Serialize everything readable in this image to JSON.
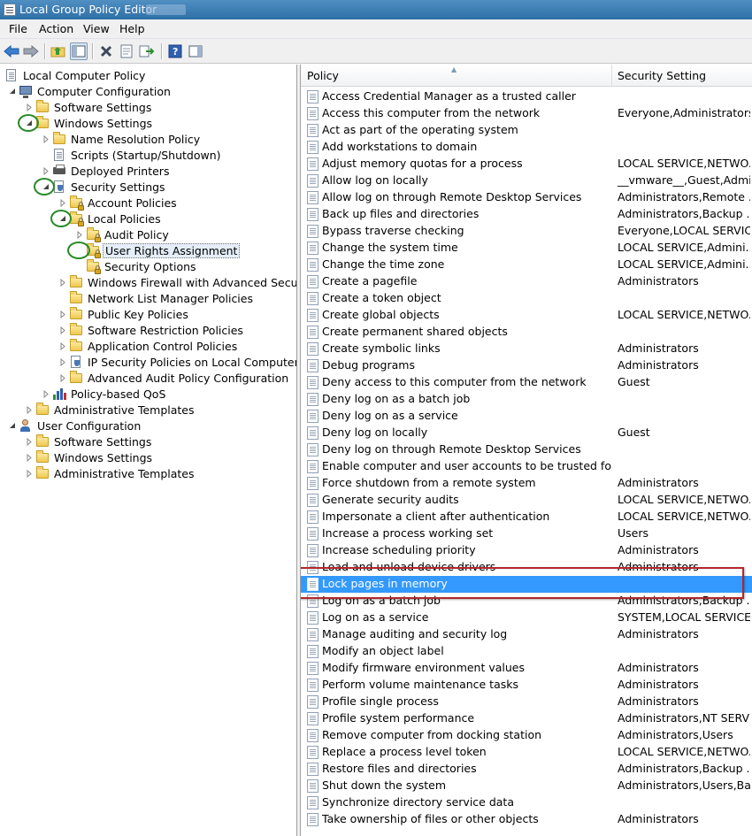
{
  "window": {
    "title": "Local Group Policy Editor"
  },
  "menu": [
    "File",
    "Action",
    "View",
    "Help"
  ],
  "toolbar": {
    "buttons": [
      "back-icon",
      "forward-icon",
      "up-folder-icon",
      "show-hide-tree-icon",
      "delete-icon",
      "properties-icon",
      "export-list-icon",
      "help-icon",
      "show-hide-action-pane-icon"
    ]
  },
  "tree": [
    {
      "label": "Local Computer Policy",
      "icon": "doc",
      "expander": "none"
    },
    {
      "label": "Computer Configuration",
      "icon": "computer",
      "expander": "expanded"
    },
    {
      "label": "Software Settings",
      "icon": "folder",
      "expander": "collapsed"
    },
    {
      "label": "Windows Settings",
      "icon": "folder",
      "expander": "expanded"
    },
    {
      "label": "Name Resolution Policy",
      "icon": "folder",
      "expander": "collapsed"
    },
    {
      "label": "Scripts (Startup/Shutdown)",
      "icon": "doc",
      "expander": "none"
    },
    {
      "label": "Deployed Printers",
      "icon": "printer",
      "expander": "collapsed"
    },
    {
      "label": "Security Settings",
      "icon": "shield",
      "expander": "expanded"
    },
    {
      "label": "Account Policies",
      "icon": "folder-lock",
      "expander": "collapsed"
    },
    {
      "label": "Local Policies",
      "icon": "folder-lock",
      "expander": "expanded"
    },
    {
      "label": "Audit Policy",
      "icon": "folder-lock",
      "expander": "collapsed"
    },
    {
      "label": "User Rights Assignment",
      "icon": "folder-lock",
      "expander": "none",
      "selected": true
    },
    {
      "label": "Security Options",
      "icon": "folder-lock",
      "expander": "none"
    },
    {
      "label": "Windows Firewall with Advanced Security",
      "icon": "folder",
      "expander": "collapsed"
    },
    {
      "label": "Network List Manager Policies",
      "icon": "folder",
      "expander": "none"
    },
    {
      "label": "Public Key Policies",
      "icon": "folder",
      "expander": "collapsed"
    },
    {
      "label": "Software Restriction Policies",
      "icon": "folder",
      "expander": "collapsed"
    },
    {
      "label": "Application Control Policies",
      "icon": "folder",
      "expander": "collapsed"
    },
    {
      "label": "IP Security Policies on Local Computer",
      "icon": "shield",
      "expander": "collapsed"
    },
    {
      "label": "Advanced Audit Policy Configuration",
      "icon": "folder",
      "expander": "collapsed"
    },
    {
      "label": "Policy-based QoS",
      "icon": "chart",
      "expander": "collapsed"
    },
    {
      "label": "Administrative Templates",
      "icon": "folder",
      "expander": "collapsed"
    },
    {
      "label": "User Configuration",
      "icon": "user",
      "expander": "expanded"
    },
    {
      "label": "Software Settings",
      "icon": "folder",
      "expander": "collapsed"
    },
    {
      "label": "Windows Settings",
      "icon": "folder",
      "expander": "collapsed"
    },
    {
      "label": "Administrative Templates",
      "icon": "folder",
      "expander": "collapsed"
    }
  ],
  "list": {
    "columns": [
      "Policy",
      "Security Setting"
    ],
    "rows": [
      {
        "policy": "Access Credential Manager as a trusted caller",
        "setting": ""
      },
      {
        "policy": "Access this computer from the network",
        "setting": "Everyone,Administrators..."
      },
      {
        "policy": "Act as part of the operating system",
        "setting": ""
      },
      {
        "policy": "Add workstations to domain",
        "setting": ""
      },
      {
        "policy": "Adjust memory quotas for a process",
        "setting": "LOCAL SERVICE,NETWO..."
      },
      {
        "policy": "Allow log on locally",
        "setting": "__vmware__,Guest,Admi..."
      },
      {
        "policy": "Allow log on through Remote Desktop Services",
        "setting": "Administrators,Remote ..."
      },
      {
        "policy": "Back up files and directories",
        "setting": "Administrators,Backup ..."
      },
      {
        "policy": "Bypass traverse checking",
        "setting": "Everyone,LOCAL SERVIC..."
      },
      {
        "policy": "Change the system time",
        "setting": "LOCAL SERVICE,Admini..."
      },
      {
        "policy": "Change the time zone",
        "setting": "LOCAL SERVICE,Admini..."
      },
      {
        "policy": "Create a pagefile",
        "setting": "Administrators"
      },
      {
        "policy": "Create a token object",
        "setting": ""
      },
      {
        "policy": "Create global objects",
        "setting": "LOCAL SERVICE,NETWO..."
      },
      {
        "policy": "Create permanent shared objects",
        "setting": ""
      },
      {
        "policy": "Create symbolic links",
        "setting": "Administrators"
      },
      {
        "policy": "Debug programs",
        "setting": "Administrators"
      },
      {
        "policy": "Deny access to this computer from the network",
        "setting": "Guest"
      },
      {
        "policy": "Deny log on as a batch job",
        "setting": ""
      },
      {
        "policy": "Deny log on as a service",
        "setting": ""
      },
      {
        "policy": "Deny log on locally",
        "setting": "Guest"
      },
      {
        "policy": "Deny log on through Remote Desktop Services",
        "setting": ""
      },
      {
        "policy": "Enable computer and user accounts to be trusted for delega...",
        "setting": ""
      },
      {
        "policy": "Force shutdown from a remote system",
        "setting": "Administrators"
      },
      {
        "policy": "Generate security audits",
        "setting": "LOCAL SERVICE,NETWO..."
      },
      {
        "policy": "Impersonate a client after authentication",
        "setting": "LOCAL SERVICE,NETWO..."
      },
      {
        "policy": "Increase a process working set",
        "setting": "Users"
      },
      {
        "policy": "Increase scheduling priority",
        "setting": "Administrators"
      },
      {
        "policy": "Load and unload device drivers",
        "setting": "Administrators"
      },
      {
        "policy": "Lock pages in memory",
        "setting": "",
        "selected": true
      },
      {
        "policy": "Log on as a batch job",
        "setting": "Administrators,Backup ..."
      },
      {
        "policy": "Log on as a service",
        "setting": "SYSTEM,LOCAL SERVICE..."
      },
      {
        "policy": "Manage auditing and security log",
        "setting": "Administrators"
      },
      {
        "policy": "Modify an object label",
        "setting": ""
      },
      {
        "policy": "Modify firmware environment values",
        "setting": "Administrators"
      },
      {
        "policy": "Perform volume maintenance tasks",
        "setting": "Administrators"
      },
      {
        "policy": "Profile single process",
        "setting": "Administrators"
      },
      {
        "policy": "Profile system performance",
        "setting": "Administrators,NT SERVI..."
      },
      {
        "policy": "Remove computer from docking station",
        "setting": "Administrators,Users"
      },
      {
        "policy": "Replace a process level token",
        "setting": "LOCAL SERVICE,NETWO..."
      },
      {
        "policy": "Restore files and directories",
        "setting": "Administrators,Backup ..."
      },
      {
        "policy": "Shut down the system",
        "setting": "Administrators,Users,Ba..."
      },
      {
        "policy": "Synchronize directory service data",
        "setting": ""
      },
      {
        "policy": "Take ownership of files or other objects",
        "setting": "Administrators"
      }
    ]
  },
  "colors": {
    "selection": "#3399ff",
    "annotation_circle": "#2a8a2a",
    "annotation_box": "#b3262a"
  }
}
